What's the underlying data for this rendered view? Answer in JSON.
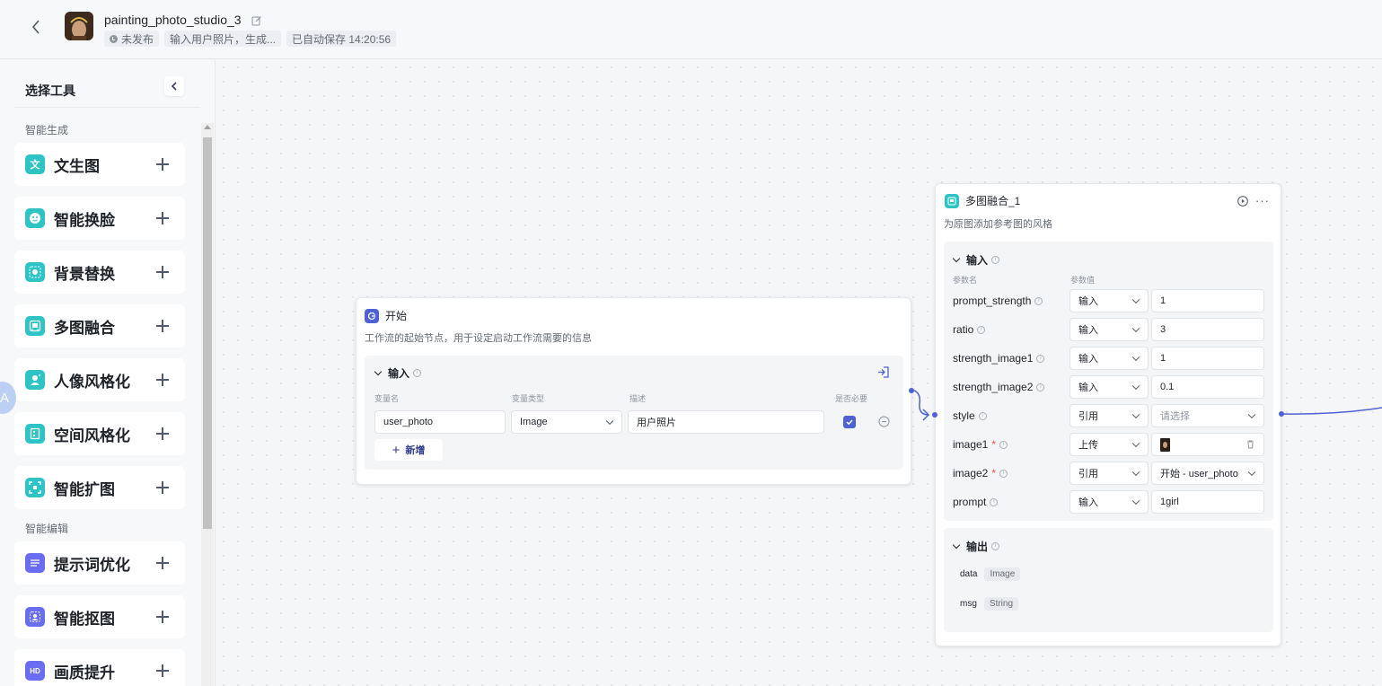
{
  "header": {
    "app_title": "painting_photo_studio_3",
    "status": "未发布",
    "description": "输入用户照片，生成...",
    "autosave": "已自动保存 14:20:56"
  },
  "sidebar": {
    "title": "选择工具",
    "sections": [
      {
        "label": "智能生成"
      },
      {
        "label": "智能编辑"
      }
    ],
    "tools": [
      {
        "label": "文生图",
        "icon": "text-to-image-icon",
        "color": "#2ec4c6",
        "glyph": "文"
      },
      {
        "label": "智能换脸",
        "icon": "face-swap-icon",
        "color": "#2ec4c6",
        "glyph": "☺"
      },
      {
        "label": "背景替换",
        "icon": "background-replace-icon",
        "color": "#2ec4c6",
        "glyph": "▦"
      },
      {
        "label": "多图融合",
        "icon": "multi-image-fusion-icon",
        "color": "#2ec4c6",
        "glyph": "⊞"
      },
      {
        "label": "人像风格化",
        "icon": "portrait-style-icon",
        "color": "#2ec4c6",
        "glyph": "👤"
      },
      {
        "label": "空间风格化",
        "icon": "space-style-icon",
        "color": "#2ec4c6",
        "glyph": "▤"
      },
      {
        "label": "智能扩图",
        "icon": "image-expand-icon",
        "color": "#2ec4c6",
        "glyph": "⤢"
      },
      {
        "label": "提示词优化",
        "icon": "prompt-optimize-icon",
        "color": "#6b6df0",
        "glyph": "≡"
      },
      {
        "label": "智能抠图",
        "icon": "smart-cutout-icon",
        "color": "#6b6df0",
        "glyph": "✂"
      },
      {
        "label": "画质提升",
        "icon": "quality-enhance-icon",
        "color": "#6b6df0",
        "glyph": "HD"
      }
    ],
    "float_badge": "A"
  },
  "start_node": {
    "title": "开始",
    "description": "工作流的起始节点，用于设定启动工作流需要的信息",
    "input_title": "输入",
    "columns": [
      "变量名",
      "变量类型",
      "描述",
      "是否必要"
    ],
    "row": {
      "name": "user_photo",
      "type": "Image",
      "desc": "用户照片",
      "required": true
    },
    "add_label": "新增"
  },
  "fusion_node": {
    "title": "多图融合_1",
    "description": "为原图添加参考图的风格",
    "input_title": "输入",
    "col_name": "参数名",
    "col_value": "参数值",
    "params": [
      {
        "name": "prompt_strength",
        "required": false,
        "mode": "输入",
        "value": "1",
        "value_kind": "text"
      },
      {
        "name": "ratio",
        "required": false,
        "mode": "输入",
        "value": "3",
        "value_kind": "text"
      },
      {
        "name": "strength_image1",
        "required": false,
        "mode": "输入",
        "value": "1",
        "value_kind": "text"
      },
      {
        "name": "strength_image2",
        "required": false,
        "mode": "输入",
        "value": "0.1",
        "value_kind": "text"
      },
      {
        "name": "style",
        "required": false,
        "mode": "引用",
        "value": "请选择",
        "value_kind": "select-placeholder"
      },
      {
        "name": "image1",
        "required": true,
        "mode": "上传",
        "value": "",
        "value_kind": "upload"
      },
      {
        "name": "image2",
        "required": true,
        "mode": "引用",
        "value": "开始 - user_photo",
        "value_kind": "select"
      },
      {
        "name": "prompt",
        "required": false,
        "mode": "输入",
        "value": "1girl",
        "value_kind": "text"
      }
    ],
    "output_title": "输出",
    "outputs": [
      {
        "name": "data",
        "type": "Image"
      },
      {
        "name": "msg",
        "type": "String"
      }
    ]
  },
  "colors": {
    "accent": "#4e62d4",
    "teal_icon": "#2ec4c6",
    "purple_icon": "#6b6df0"
  }
}
